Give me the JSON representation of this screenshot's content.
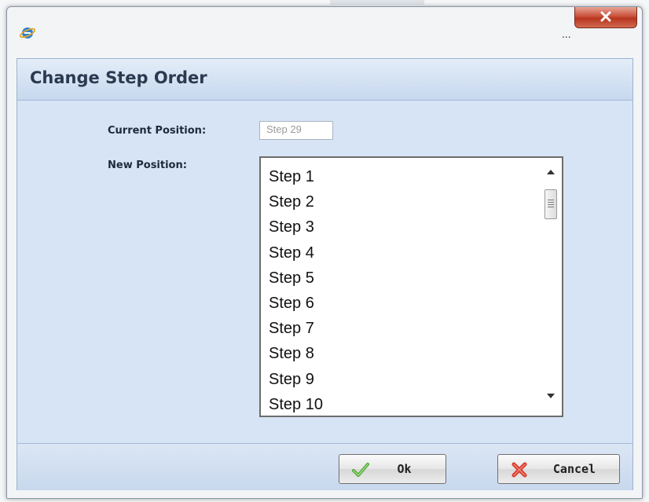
{
  "window": {
    "title_ellipsis": "...",
    "close_label": "X"
  },
  "dialog": {
    "title": "Change Step Order",
    "current_position_label": "Current Position:",
    "current_position_value": "Step 29",
    "new_position_label": "New Position:"
  },
  "list": {
    "items": [
      "Step 1",
      "Step 2",
      "Step 3",
      "Step 4",
      "Step 5",
      "Step 6",
      "Step 7",
      "Step 8",
      "Step 9",
      "Step 10"
    ]
  },
  "buttons": {
    "ok_label": "Ok",
    "cancel_label": "Cancel"
  },
  "icons": {
    "app": "ie-icon",
    "close": "close-icon",
    "ok": "checkmark-icon",
    "cancel": "red-x-icon",
    "scroll_up": "scroll-up-arrow-icon",
    "scroll_down": "scroll-down-arrow-icon"
  },
  "colors": {
    "content_bg": "#d6e4f5",
    "close_red": "#c9503b",
    "check_green": "#4aa836",
    "cancel_red": "#d93a2b"
  }
}
